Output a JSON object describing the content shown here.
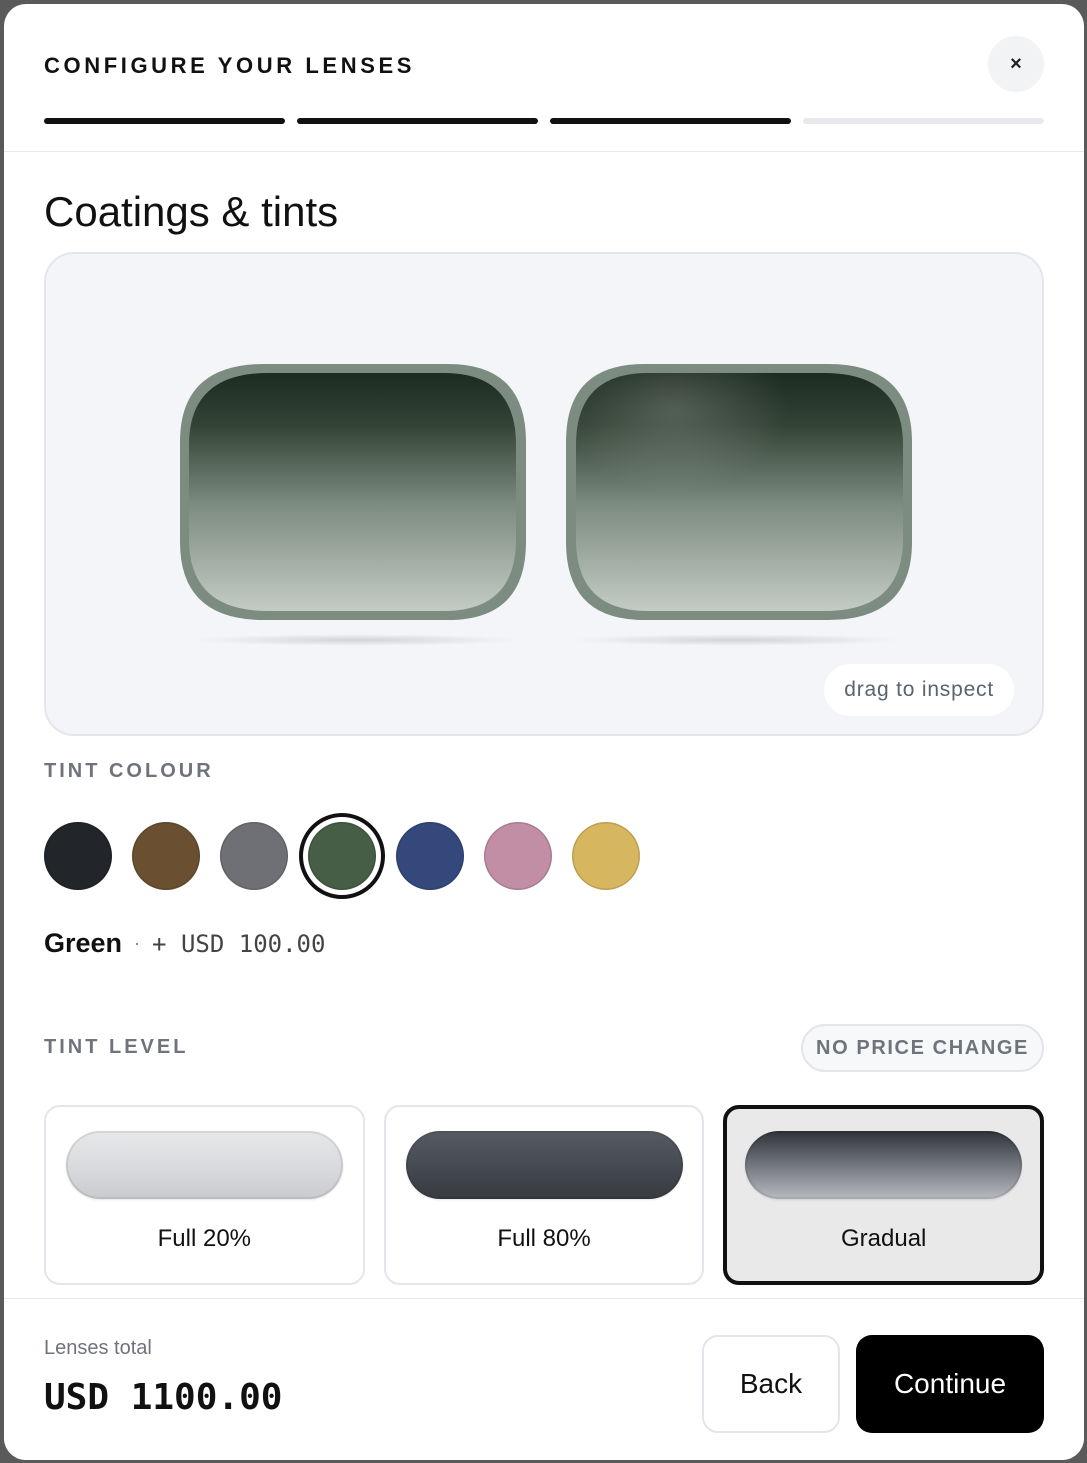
{
  "header": {
    "title": "CONFIGURE YOUR LENSES",
    "close_label": "×",
    "progress": {
      "total_steps": 4,
      "completed_steps": 3
    }
  },
  "section": {
    "title": "Coatings & tints"
  },
  "preview": {
    "hint": "drag to inspect",
    "lens_color": "#45604b"
  },
  "tint_colour": {
    "label": "TINT COLOUR",
    "swatches": [
      {
        "color": "#22252a"
      },
      {
        "color": "#6a5030"
      },
      {
        "color": "#6e7075"
      },
      {
        "color": "#455e45",
        "selected": true
      },
      {
        "color": "#34487c"
      },
      {
        "color": "#c28ea6"
      },
      {
        "color": "#d6b65e"
      }
    ],
    "selected_name": "Green",
    "separator": "·",
    "selected_price": "+ USD 100.00"
  },
  "tint_level": {
    "label": "TINT LEVEL",
    "price_note": "NO PRICE CHANGE",
    "options": [
      {
        "label": "Full 20%",
        "selected": false
      },
      {
        "label": "Full 80%",
        "selected": false
      },
      {
        "label": "Gradual",
        "selected": true
      }
    ]
  },
  "footer": {
    "total_label": "Lenses total",
    "total_value": "USD 1100.00",
    "back_label": "Back",
    "continue_label": "Continue"
  }
}
